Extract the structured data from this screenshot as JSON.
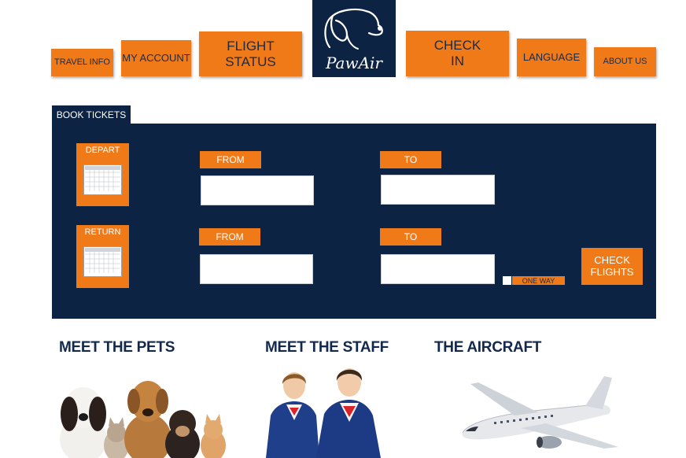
{
  "nav": {
    "travel_info": "TRAVEL INFO",
    "my_account": "MY ACCOUNT",
    "flight_status": "FLIGHT STATUS",
    "check_in": "CHECK IN",
    "language": "LANGUAGE",
    "about_us": "ABOUT US"
  },
  "logo": {
    "text": "PawAir",
    "icon": "dog-head-icon"
  },
  "booking": {
    "tab_label": "BOOK TICKETS",
    "depart_label": "DEPART",
    "return_label": "RETURN",
    "from_label": "FROM",
    "to_label": "TO",
    "depart_from_value": "",
    "depart_to_value": "",
    "return_from_value": "",
    "return_to_value": "",
    "one_way_label": "ONE WAY",
    "check_flights_label": "CHECK FLIGHTS",
    "calendar_icon": "calendar-icon"
  },
  "sections": {
    "pets_title": "MEET THE PETS",
    "staff_title": "MEET THE STAFF",
    "aircraft_title": "THE AIRCRAFT"
  },
  "colors": {
    "accent": "#f07a18",
    "navy": "#0d2344",
    "heading": "#13294b"
  }
}
